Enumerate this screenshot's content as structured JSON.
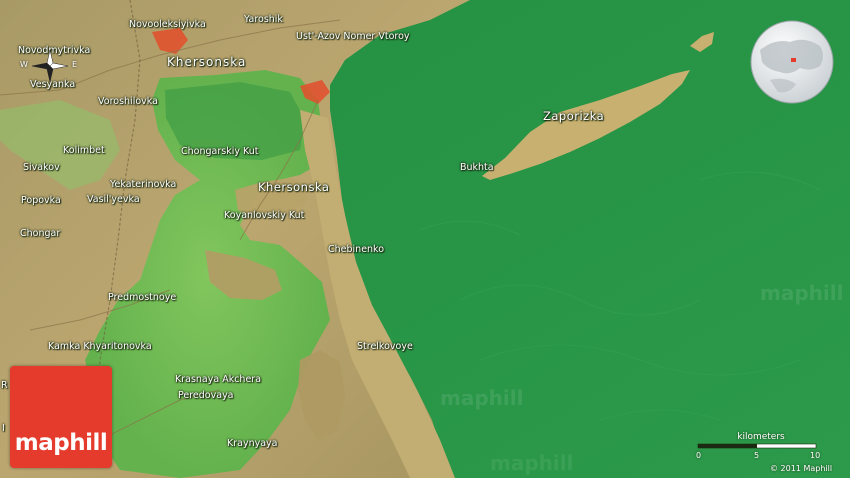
{
  "map": {
    "places": [
      {
        "id": "novooleksiyivka",
        "name": "Novooleksiyivka"
      },
      {
        "id": "yaroshik",
        "name": "Yaroshik"
      },
      {
        "id": "ust-azov",
        "name": "Ust'-Azov Nomer Vtoroy"
      },
      {
        "id": "novodmytrivka",
        "name": "Novodmytrivka"
      },
      {
        "id": "khersonska-region",
        "name": "Khersonska"
      },
      {
        "id": "vesyanka",
        "name": "Vesyanka"
      },
      {
        "id": "voroshilovka",
        "name": "Voroshilovka"
      },
      {
        "id": "zaporizka",
        "name": "Zaporizka"
      },
      {
        "id": "kolimbet",
        "name": "Kolimbet"
      },
      {
        "id": "chongarskiy-kut",
        "name": "Chongarskiy Kut"
      },
      {
        "id": "sivakov",
        "name": "Sivakov"
      },
      {
        "id": "bukhta",
        "name": "Bukhta"
      },
      {
        "id": "yekaterinovka",
        "name": "Yekaterinovka"
      },
      {
        "id": "khersonska-town",
        "name": "Khersonska"
      },
      {
        "id": "popovka",
        "name": "Popovka"
      },
      {
        "id": "vasilyevka",
        "name": "Vasil'yevka"
      },
      {
        "id": "koyanlovskiy-kut",
        "name": "Koyanlovskiy Kut"
      },
      {
        "id": "chongar",
        "name": "Chongar"
      },
      {
        "id": "chebinenko",
        "name": "Chebinenko"
      },
      {
        "id": "predmostnoye",
        "name": "Predmostnoye"
      },
      {
        "id": "strelkovoye",
        "name": "Strelkovoye"
      },
      {
        "id": "kamka-khyaritonovka",
        "name": "Kamka Khyaritonovka"
      },
      {
        "id": "krasnaya-akchera",
        "name": "Krasnaya Akchera"
      },
      {
        "id": "peredovaya",
        "name": "Peredovaya"
      },
      {
        "id": "kraynyaya",
        "name": "Kraynyaya"
      },
      {
        "id": "edge-r",
        "name": "R"
      },
      {
        "id": "edge-i",
        "name": "I"
      }
    ],
    "compass": {
      "west": "W",
      "east": "E"
    },
    "scale": {
      "title": "kilometers",
      "ticks": [
        "0",
        "5",
        "10"
      ]
    },
    "copyright": "© 2011 Maphill",
    "logo_text": "maphill",
    "watermark": "maphill",
    "colors": {
      "sea": "#2a9848",
      "land": "#b8a46a",
      "lagoon": "#4caf50",
      "urban": "#e0522f",
      "logo": "#e43b2c"
    }
  }
}
